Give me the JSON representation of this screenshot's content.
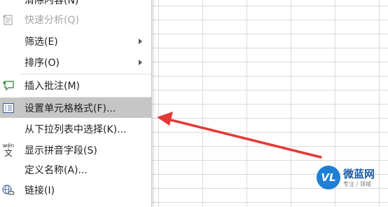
{
  "menu": {
    "items": [
      {
        "label": "清除内容(N)",
        "disabled": false
      },
      {
        "label": "快速分析(Q)",
        "disabled": true
      },
      {
        "label": "筛选(E)",
        "has_submenu": true
      },
      {
        "label": "排序(O)",
        "has_submenu": true
      },
      {
        "label": "插入批注(M)"
      },
      {
        "label": "设置单元格格式(F)...",
        "highlighted": true
      },
      {
        "label": "从下拉列表中选择(K)..."
      },
      {
        "label": "显示拼音字段(S)"
      },
      {
        "label": "定义名称(A)..."
      },
      {
        "label": "链接(I)"
      }
    ],
    "icons": {
      "quick_analysis": "quick-analysis-icon",
      "comment": "comment-icon",
      "format_cells": "format-cells-icon",
      "phonetic": "phonetic-icon",
      "phonetic_glyph_top": "wén",
      "phonetic_glyph_bottom": "文",
      "link": "link-icon"
    }
  },
  "watermark": {
    "logo_text": "VL",
    "title": "微蓝网",
    "subtitle": "专注 / 领域"
  },
  "colors": {
    "highlight": "#c6c6c6",
    "arrow": "#e53935",
    "watermark_blue": "#1f7fd6"
  }
}
